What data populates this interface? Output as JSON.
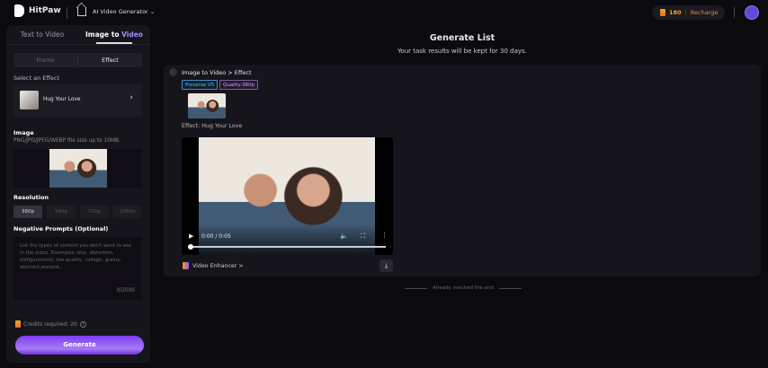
{
  "header": {
    "brand": "HitPaw",
    "app": "AI Video Generator",
    "credits": "180",
    "recharge": "Recharge"
  },
  "sidebar": {
    "tabs": [
      "Text to Video",
      "Image to ",
      "Video"
    ],
    "modes": [
      "Frame",
      "Effect"
    ],
    "select_effect": "Select an Effect",
    "effect_name": "Hug Your Love",
    "image_label": "Image",
    "image_hint": "PNG/JPG/JPEG/WEBP file size up to 10MB.",
    "resolution_label": "Resolution",
    "resolutions": [
      "360p",
      "540p",
      "720p",
      "1080p"
    ],
    "neg_label": "Negative Prompts (Optional)",
    "neg_placeholder": "List the types of content you don't want to see in the video. Examples: blur, distortion, disfigurement, low quality, collage, grainy, abstract,warped...",
    "neg_count": "0/2000",
    "credits_required": "Credits required: 20",
    "generate": "Generate"
  },
  "main": {
    "title": "Generate List",
    "subtitle": "Your task results will be kept for 30 days.",
    "task": {
      "breadcrumb": "Image to Video > Effect",
      "model_tag": "Pixverse V5",
      "quality_tag": "Quality:360p",
      "effect": "Effect: Hug Your Love",
      "time": "0:00 / 0:05",
      "enhancer": "Video Enhancer >"
    },
    "end_text": "Already reached the end"
  },
  "colors": {
    "accent": "#8b5cf6",
    "credits": "#f5a623"
  }
}
